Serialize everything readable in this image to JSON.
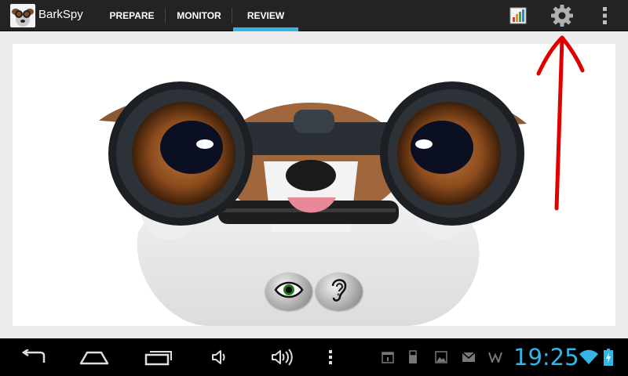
{
  "app": {
    "title": "BarkSpy"
  },
  "tabs": [
    {
      "label": "PREPARE"
    },
    {
      "label": "MONITOR"
    },
    {
      "label": "REVIEW"
    }
  ],
  "selected_tab": "REVIEW",
  "status": {
    "time": "19:25"
  },
  "icons": {
    "actionbar": [
      "stats-chart-icon",
      "gear-icon",
      "overflow-menu-icon"
    ],
    "content": [
      "eye-icon",
      "ear-icon"
    ],
    "nav": [
      "back-icon",
      "home-icon",
      "recent-apps-icon",
      "volume-down-icon",
      "volume-up-icon",
      "menu-icon"
    ],
    "status": [
      "calendar-icon",
      "usb-icon",
      "gallery-icon",
      "gmail-icon",
      "notification-icon",
      "wifi-icon",
      "battery-charging-icon"
    ]
  },
  "colors": {
    "accent": "#33b5e5",
    "actionbar": "#232323",
    "annotation_arrow": "#e00000"
  }
}
